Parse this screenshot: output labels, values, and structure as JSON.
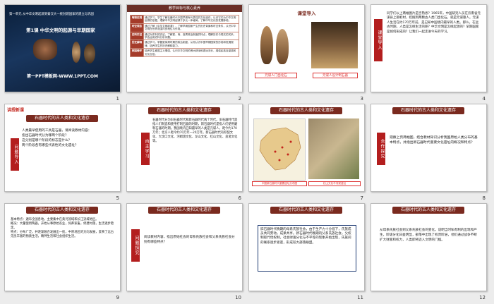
{
  "slides": {
    "s1": {
      "num": "1",
      "unit": "第一单元  从中华文明起源到秦汉大一统封建国家的建立与巩固",
      "lesson": "第1课    中华文明的起源与早期国家",
      "site": "第一PPT模板网-WWW.1PPT.COM"
    },
    "s2": {
      "num": "2",
      "title": "教学目标与核心素养",
      "rows": [
        {
          "h": "唯物史观",
          "t": "通过学习，学生了解石器时代中国早期有代表性的文化遗存，认识它们为中华文明起源的依据，理解中华文明起源于多元一体格局，了解中华文化的发展脉络。"
        },
        {
          "h": "时空观念",
          "t": "通过了解《中华文明起源》，了解早期国家产生的历史背景和时空条件，认识中华文明在世界范围内的地位与作用。"
        },
        {
          "h": "史料实证",
          "t": "通过对史料的实证，了解夏、商、西周政治制度的特点，理解历史与现实的关系，学会运用史料分析问题。"
        },
        {
          "h": "历史解释",
          "t": "通过学习，掌握夏商周时期的政治制度，从而认识中国早期国家的形成和发展规律，培养学生的历史解释能力。"
        },
        {
          "h": "家国情怀",
          "t": "培养学生爱国主义情感，认识中华文明的博大精深和源远流长，增强民族自豪感和文化自信。"
        }
      ]
    },
    "s3": {
      "num": "3",
      "title": "课堂导入",
      "cap1": "元谋人门齿化石",
      "cap2": "元谋人设计制石器"
    },
    "s4": {
      "num": "4",
      "label": "课堂导入",
      "text": "同学们以上两幅图片是否熟悉？1965年，中国研究人员在云南省元谋县上那蚌村，挖掘到两颗古人类门齿化石，就是元谋猿人。元谋人生活在约170万年前，是已知中国境内最早的人类。那么，在远古时期，人类是怎样生活的呢？中华文明是怎样起源的？早期国家是如何形成的？让我们一起走进今天的学习。"
    },
    "s5": {
      "num": "5",
      "tag": "讲授新课",
      "title": "石器时代的古人类和文化遗存",
      "label": "问题导入",
      "q1": "人类最早使用的工具是石器，请阅读教材内容：",
      "q2": "指出石器时代分为哪两个阶段？",
      "q3": "这分别是哪个阶段的标志是什么？",
      "q4": "两个阶段各有哪些代表性的文化遗址？"
    },
    "s6": {
      "num": "6",
      "title": "石器时代的古人类和文化遗存",
      "label": "自主学习",
      "text": "石器时代分为旧石器时代和新石器时代两个时代。旧石器时代是指人们制造和使用打制石器的时期，新石器时代是指人们使用磨制石器的时期。我国境内已知最早的人类是元谋人，距今约170万年；北京人距今约70万年—20万年。新石器时代有仰韶文化、大汶口文化、河姆渡文化、龙山文化、红山文化、良渚文化等。"
    },
    "s7": {
      "num": "7",
      "title": "石器时代的古人类和文化遗存",
      "cap1": "中国新石器时代重要遗址分布图",
      "cap2": "红山文化牛河梁遗址"
    },
    "s8": {
      "num": "8",
      "title": "石器时代的古人类和文化遗存",
      "label": "合作探究",
      "text": "观察上页两幅图，结合教材知识分析我国原始人类分布的基本特点，并指出新石器时代重要文化遗址的概况和特点？"
    },
    "s9": {
      "num": "9",
      "title": "石器时代的古人类和文化遗存",
      "p1": "基本特点：遍布全国各地，主要集中在黄河流域和长江流域地区。",
      "p2": "概况：大量使用陶器，开始从事原始农业，饲养家畜，修建村落，生活逐步稳定。",
      "p3": "特点：分布广泛，并逐渐融合发展出一批，中原地区的方向发展，反映了远古先民丰富的物质生活，精神生活和社会组织生活。"
    },
    "s10": {
      "num": "10",
      "title": "石器时代的古人类和文化遗存",
      "label": "问题探究",
      "text": "阅读教材内容，指出原始社会的母系氏族社会和父系氏族社会分别有哪些特点？"
    },
    "s11": {
      "num": "11",
      "title": "石器时代的古人类和文化遗存",
      "text": "旧石器时代晚期的母系氏族社会，由于生产力十分低下，氏族成员共同劳动，成果共享。新石器时代晚期的父系氏族社会，父权制取代母权制，社会财富分化与不平等的现象开始出现，氏族间的联系逐步紧密，形成较大部落联盟。"
    },
    "s12": {
      "num": "12",
      "title": "石器时代的古人类和文化遗存",
      "text": "从母系氏族社会到父系氏族社会的变化，说明当时私有制的出现和产生，阶级分化日益明显，部落中出现了权贵阶层，他们通过战争不断扩大财富和权力，人类即将迈入文明的门槛。"
    }
  }
}
